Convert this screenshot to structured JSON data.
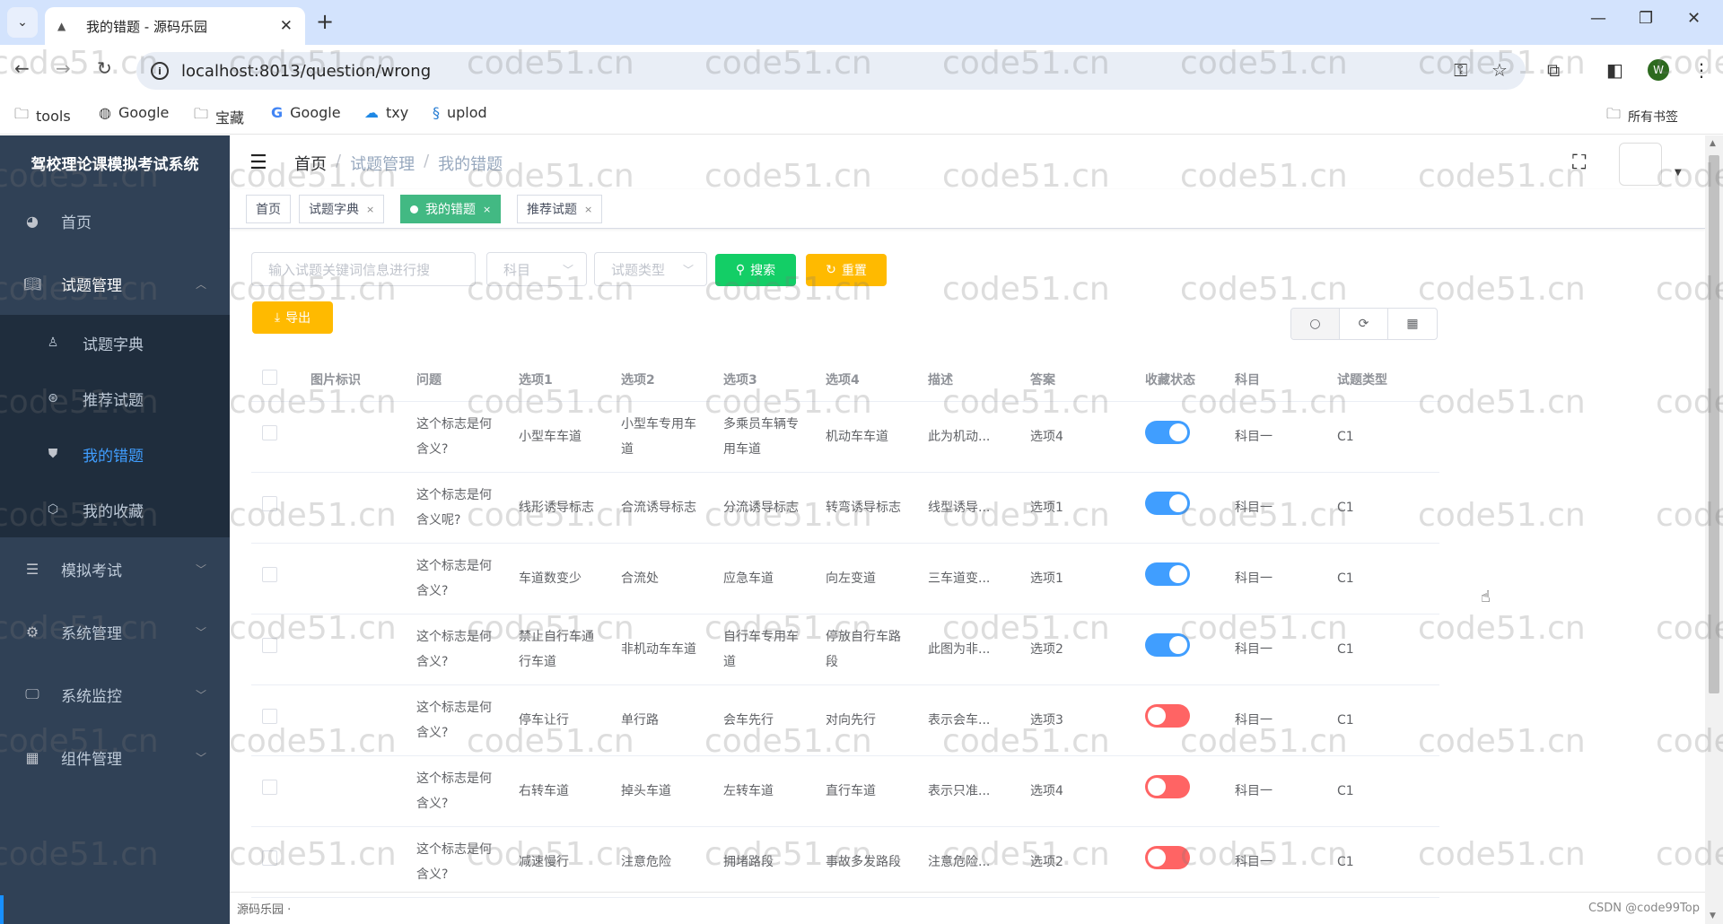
{
  "browser": {
    "tab_title": "我的错题 - 源码乐园",
    "url": "localhost:8013/question/wrong",
    "profile_initial": "W",
    "bookmarks": [
      {
        "label": "tools",
        "icon": "folder-icon"
      },
      {
        "label": "Google",
        "icon": "globe-icon"
      },
      {
        "label": "宝藏",
        "icon": "folder-icon"
      },
      {
        "label": "Google",
        "icon": "google-icon"
      },
      {
        "label": "txy",
        "icon": "cloud-icon"
      },
      {
        "label": "uplod",
        "icon": "link-icon"
      }
    ],
    "all_bookmarks": "所有书签"
  },
  "sidebar": {
    "title": "驾校理论课模拟考试系统",
    "items": [
      {
        "label": "首页",
        "icon": "dashboard-icon"
      },
      {
        "label": "试题管理",
        "icon": "book-icon",
        "open": true,
        "children": [
          {
            "label": "试题字典",
            "icon": "user-icon"
          },
          {
            "label": "推荐试题",
            "icon": "education-icon"
          },
          {
            "label": "我的错题",
            "icon": "shield-icon",
            "active": true
          },
          {
            "label": "我的收藏",
            "icon": "cube-icon"
          }
        ]
      },
      {
        "label": "模拟考试",
        "icon": "database-icon"
      },
      {
        "label": "系统管理",
        "icon": "gear-icon"
      },
      {
        "label": "系统监控",
        "icon": "monitor-icon"
      },
      {
        "label": "组件管理",
        "icon": "grid-icon"
      }
    ]
  },
  "breadcrumb": [
    "首页",
    "试题管理",
    "我的错题"
  ],
  "tags": [
    {
      "label": "首页",
      "closable": false,
      "active": false
    },
    {
      "label": "试题字典",
      "closable": true,
      "active": false
    },
    {
      "label": "我的错题",
      "closable": true,
      "active": true
    },
    {
      "label": "推荐试题",
      "closable": true,
      "active": false
    }
  ],
  "filters": {
    "keyword_placeholder": "输入试题关键词信息进行搜",
    "subject_placeholder": "科目",
    "type_placeholder": "试题类型",
    "search_label": "搜索",
    "reset_label": "重置",
    "export_label": "导出"
  },
  "table": {
    "columns": [
      "图片标识",
      "问题",
      "选项1",
      "选项2",
      "选项3",
      "选项4",
      "描述",
      "答案",
      "收藏状态",
      "科目",
      "试题类型"
    ],
    "rows": [
      {
        "image": "",
        "question": "这个标志是何含义?",
        "opt1": "小型车车道",
        "opt2": "小型车专用车道",
        "opt3": "多乘员车辆专用车道",
        "opt4": "机动车车道",
        "desc": "此为机动...",
        "answer": "选项4",
        "favorite": true,
        "subject": "科目一",
        "type": "C1"
      },
      {
        "image": "",
        "question": "这个标志是何含义呢?",
        "opt1": "线形诱导标志",
        "opt2": "合流诱导标志",
        "opt3": "分流诱导标志",
        "opt4": "转弯诱导标志",
        "desc": "线型诱导...",
        "answer": "选项1",
        "favorite": true,
        "subject": "科目一",
        "type": "C1"
      },
      {
        "image": "",
        "question": "这个标志是何含义?",
        "opt1": "车道数变少",
        "opt2": "合流处",
        "opt3": "应急车道",
        "opt4": "向左变道",
        "desc": "三车道变...",
        "answer": "选项1",
        "favorite": true,
        "subject": "科目一",
        "type": "C1"
      },
      {
        "image": "",
        "question": "这个标志是何含义?",
        "opt1": "禁止自行车通行车道",
        "opt2": "非机动车车道",
        "opt3": "自行车专用车道",
        "opt4": "停放自行车路段",
        "desc": "此图为非...",
        "answer": "选项2",
        "favorite": true,
        "subject": "科目一",
        "type": "C1"
      },
      {
        "image": "",
        "question": "这个标志是何含义?",
        "opt1": "停车让行",
        "opt2": "单行路",
        "opt3": "会车先行",
        "opt4": "对向先行",
        "desc": "表示会车...",
        "answer": "选项3",
        "favorite": false,
        "subject": "科目一",
        "type": "C1"
      },
      {
        "image": "",
        "question": "这个标志是何含义?",
        "opt1": "右转车道",
        "opt2": "掉头车道",
        "opt3": "左转车道",
        "opt4": "直行车道",
        "desc": "表示只准...",
        "answer": "选项4",
        "favorite": false,
        "subject": "科目一",
        "type": "C1"
      },
      {
        "image": "",
        "question": "这个标志是何含义?",
        "opt1": "减速慢行",
        "opt2": "注意危险",
        "opt3": "拥堵路段",
        "opt4": "事故多发路段",
        "desc": "注意危险...",
        "answer": "选项2",
        "favorite": false,
        "subject": "科目一",
        "type": "C1"
      }
    ]
  },
  "footer": {
    "left": "源码乐园 ·",
    "credit": "CSDN @code99Top"
  },
  "watermark": "code51.cn",
  "colors": {
    "sidebar_bg": "#304156",
    "submenu_bg": "#1f2d3d",
    "active_menu": "#409eff",
    "tag_active": "#42b983",
    "search_btn": "#13ce66",
    "reset_btn": "#ffba00",
    "switch_on": "#409eff",
    "switch_off": "#ff4949"
  }
}
